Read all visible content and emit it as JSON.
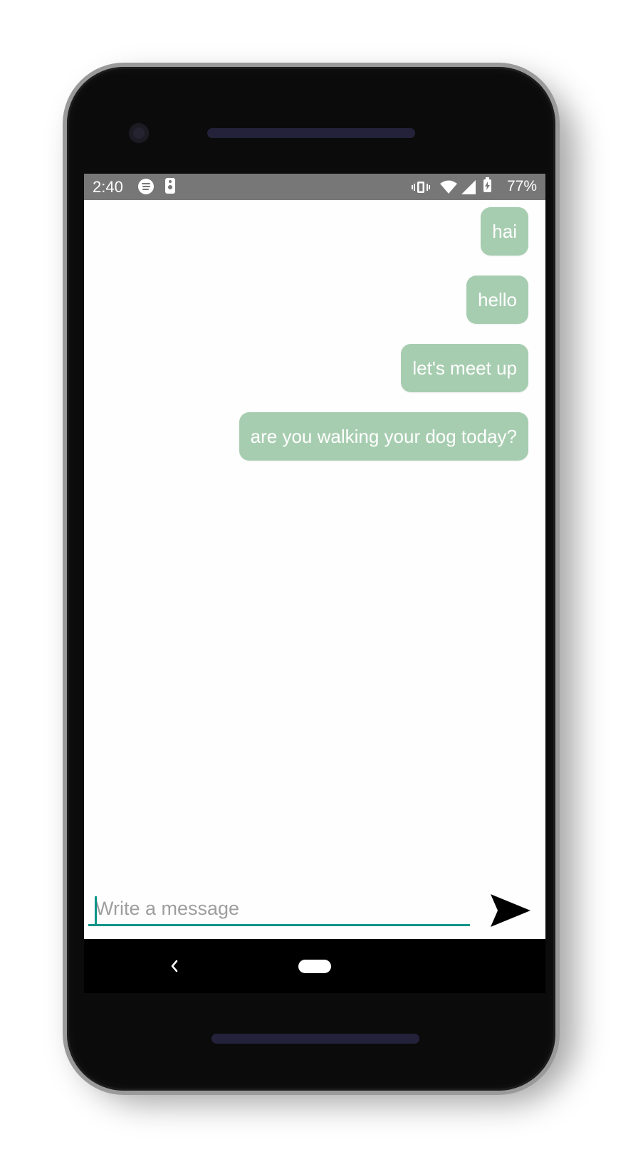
{
  "status_bar": {
    "time": "2:40",
    "battery_percent": "77%",
    "icons": [
      "spotify-icon",
      "speaker-app-icon",
      "vibrate-icon",
      "wifi-icon",
      "signal-icon",
      "battery-charging-icon"
    ]
  },
  "messages": [
    {
      "text": "hai",
      "direction": "outgoing"
    },
    {
      "text": "hello",
      "direction": "outgoing"
    },
    {
      "text": "let's meet up",
      "direction": "outgoing"
    },
    {
      "text": "are you walking your dog today?",
      "direction": "outgoing"
    }
  ],
  "composer": {
    "placeholder": "Write a message",
    "value": "",
    "send_icon": "send-arrow-icon"
  },
  "nav_bar": {
    "icons": [
      "back-icon",
      "home-pill"
    ]
  },
  "colors": {
    "bubble": "#a7cdb0",
    "accent": "#0f9488",
    "status_bar": "#777777"
  }
}
